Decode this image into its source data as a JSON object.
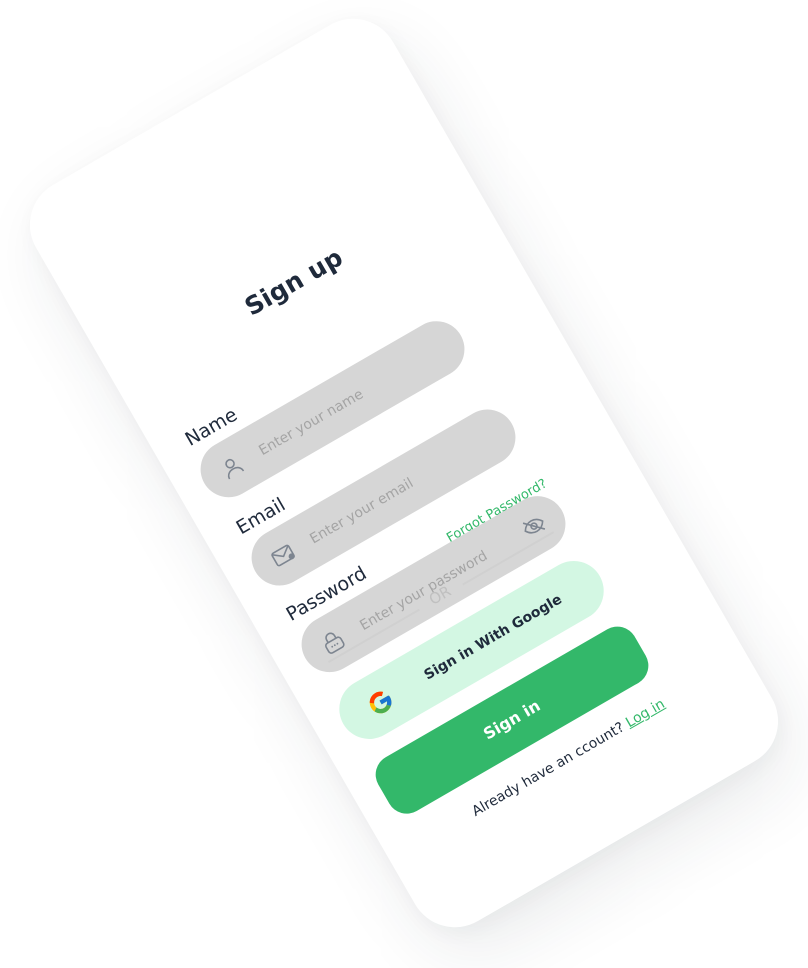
{
  "form": {
    "title": "Sign up",
    "name_label": "Name",
    "name_placeholder": "Enter your name",
    "email_label": "Email",
    "email_placeholder": "Enter your email",
    "password_label": "Password",
    "password_placeholder": "Enter your password",
    "forgot_password": "Forgot Password?",
    "divider_text": "OR",
    "google_button": "Sign in With Google",
    "signin_button": "Sign in",
    "footer_text": "Already have an ccount?",
    "login_link": "Log in"
  },
  "icons": {
    "name": "user-icon",
    "email": "mail-icon",
    "password": "lock-icon",
    "toggle": "eye-off-icon",
    "google": "google-icon"
  },
  "colors": {
    "accent": "#33b86a",
    "accent_light": "#d3f7e3",
    "field_bg": "#d6d6d6",
    "text_dark": "#1f2a3b",
    "placeholder": "#a4a4a4"
  }
}
